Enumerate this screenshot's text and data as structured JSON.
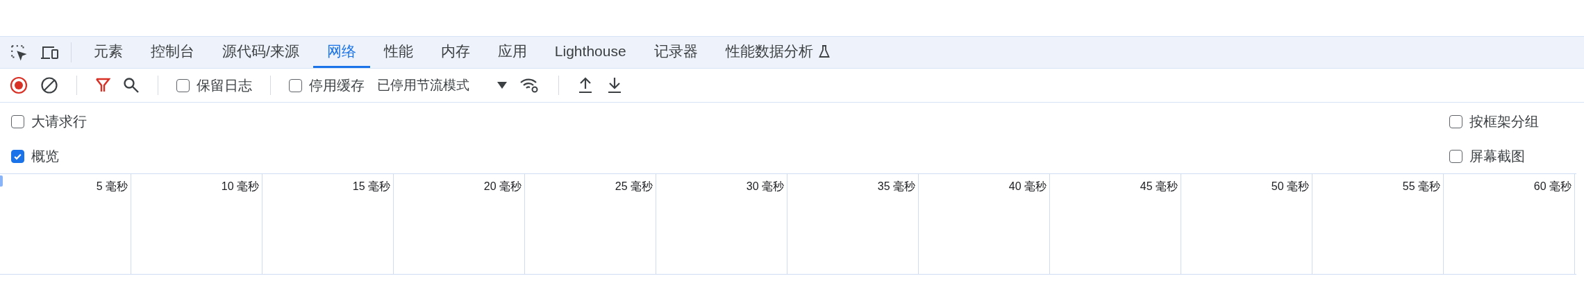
{
  "tabs": [
    {
      "label": "元素",
      "selected": false
    },
    {
      "label": "控制台",
      "selected": false
    },
    {
      "label": "源代码/来源",
      "selected": false
    },
    {
      "label": "网络",
      "selected": true
    },
    {
      "label": "性能",
      "selected": false
    },
    {
      "label": "内存",
      "selected": false
    },
    {
      "label": "应用",
      "selected": false
    },
    {
      "label": "Lighthouse",
      "selected": false
    },
    {
      "label": "记录器",
      "selected": false
    },
    {
      "label": "性能数据分析",
      "selected": false,
      "experimental": true
    }
  ],
  "toolbar": {
    "recording": true,
    "filter_active": true,
    "preserve_log": {
      "label": "保留日志",
      "checked": false
    },
    "disable_cache": {
      "label": "停用缓存",
      "checked": false
    },
    "throttling": {
      "value": "已停用节流模式"
    }
  },
  "options_left": [
    {
      "label": "大请求行",
      "checked": false
    },
    {
      "label": "概览",
      "checked": true
    }
  ],
  "options_right": [
    {
      "label": "按框架分组",
      "checked": false
    },
    {
      "label": "屏幕截图",
      "checked": false
    }
  ],
  "timeline": {
    "ticks": [
      "5 毫秒",
      "10 毫秒",
      "15 毫秒",
      "20 毫秒",
      "25 毫秒",
      "30 毫秒",
      "35 毫秒",
      "40 毫秒",
      "45 毫秒",
      "50 毫秒",
      "55 毫秒",
      "60 毫秒"
    ]
  }
}
